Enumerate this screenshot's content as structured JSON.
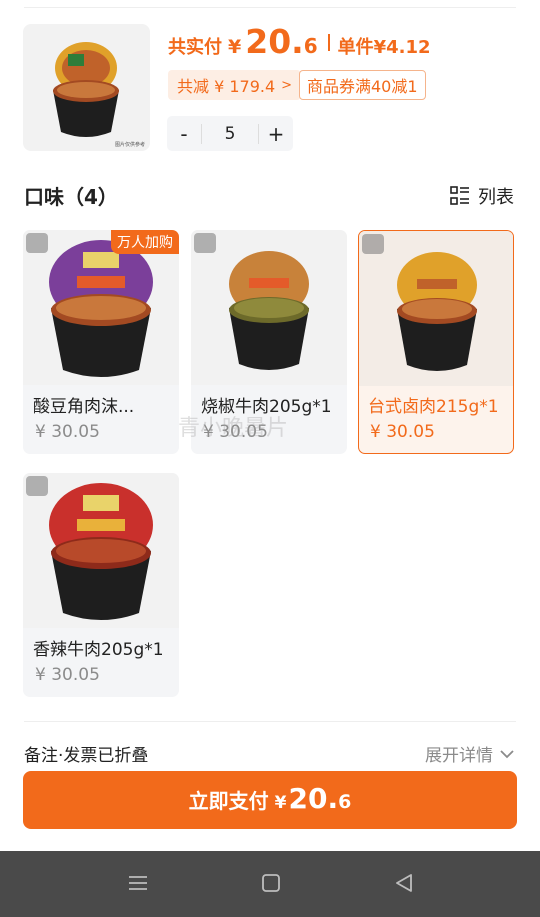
{
  "product": {
    "total_label": "共实付",
    "total_currency": "¥",
    "total_int": "20.",
    "total_dec": "6",
    "unit_label": "单件",
    "unit_price": "¥4.12",
    "discount_text": "共减 ¥ 179.4",
    "discount_chevron": ">",
    "coupon_text": "商品券满40减1",
    "image_note": "图片仅供参考"
  },
  "stepper": {
    "minus": "-",
    "value": "5",
    "plus": "+"
  },
  "flavor": {
    "title": "口味（4）",
    "view_label": "列表",
    "options": [
      {
        "name": "酸豆角肉沫...",
        "price": "¥ 30.05",
        "badge": "万人加购",
        "lid_color": "#7b3f9a",
        "selected": false
      },
      {
        "name": "烧椒牛肉205g*1",
        "price": "¥ 30.05",
        "badge": "",
        "lid_color": "#c8823a",
        "selected": false
      },
      {
        "name": "台式卤肉215g*1",
        "price": "¥ 30.05",
        "badge": "",
        "lid_color": "#e0a12a",
        "selected": true
      },
      {
        "name": "香辣牛肉205g*1",
        "price": "¥ 30.05",
        "badge": "",
        "lid_color": "#c9302c",
        "selected": false
      }
    ]
  },
  "watermark": "青小晚暑片",
  "remark": {
    "label": "备注·发票已折叠",
    "expand_label": "展开详情"
  },
  "pay": {
    "label": "立即支付",
    "currency": "¥",
    "amount_int": "20.",
    "amount_dec": "6"
  },
  "colors": {
    "accent": "#f26a1b",
    "card_bg": "#f4f5f7",
    "nav_bg": "#4a4a4a"
  },
  "nav": {
    "icons": [
      "menu-icon",
      "home-square-icon",
      "back-triangle-icon"
    ]
  }
}
